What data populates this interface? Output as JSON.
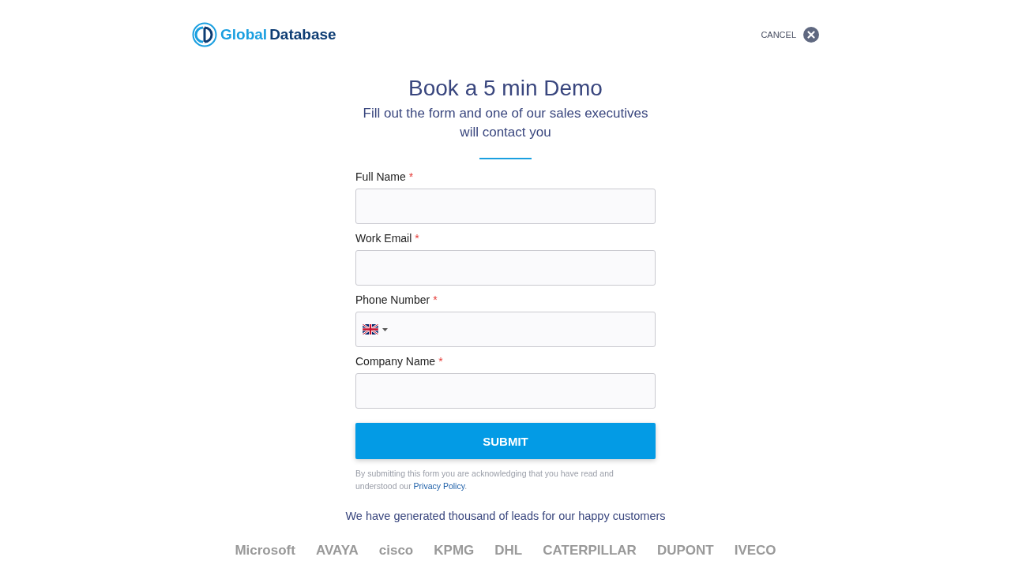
{
  "header": {
    "logo": {
      "part_1": "Global",
      "part_2": "Database"
    },
    "cancel": "CANCEL"
  },
  "title": "Book a 5 min Demo",
  "subtitle": "Fill out the form and one of our sales executives will contact you",
  "fields": [
    {
      "label": "Full Name",
      "required": "*",
      "kind": "text"
    },
    {
      "label": "Work Email",
      "required": "*",
      "kind": "text"
    },
    {
      "label": "Phone Number",
      "required": "*",
      "kind": "phone"
    },
    {
      "label": "Company Name",
      "required": "*",
      "kind": "text"
    }
  ],
  "submit": "SUBMIT",
  "disclaimer": {
    "text": "By submitting this form you are acknowledging that you have read and understood our ",
    "link": "Privacy Policy",
    "end": "."
  },
  "customers_text": "We have generated thousand of leads for our happy customers",
  "customer_logos": [
    "Microsoft",
    "AVAYA",
    "cisco",
    "KPMG",
    "DHL",
    "CATERPILLAR",
    "DUPONT",
    "IVECO"
  ]
}
